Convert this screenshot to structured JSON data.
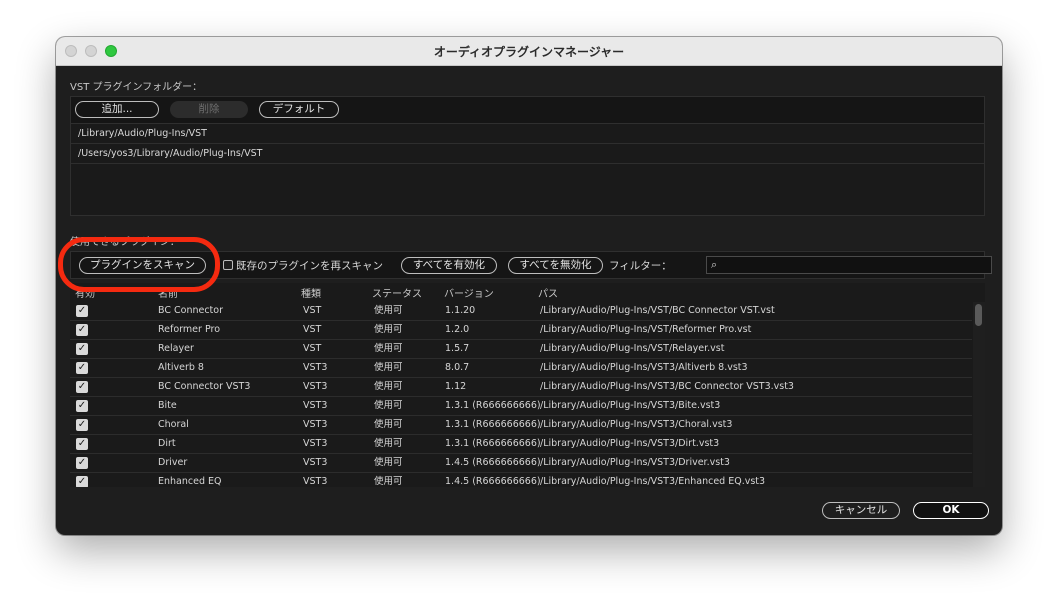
{
  "window": {
    "title": "オーディオプラグインマネージャー"
  },
  "vst_folders": {
    "label": "VST プラグインフォルダー：",
    "add_label": "追加...",
    "delete_label": "削除",
    "default_label": "デフォルト",
    "paths": [
      "/Library/Audio/Plug-Ins/VST",
      "/Users/yos3/Library/Audio/Plug-Ins/VST"
    ]
  },
  "plugins": {
    "label": "使用できるプラグイン：",
    "scan_label": "プラグインをスキャン",
    "rescan_label": "既存のプラグインを再スキャン",
    "enable_all_label": "すべてを有効化",
    "disable_all_label": "すべてを無効化",
    "filter_label": "フィルター：",
    "filter_value": "",
    "columns": {
      "enabled": "有効",
      "name": "名前",
      "type": "種類",
      "status": "ステータス",
      "version": "バージョン",
      "path": "パス"
    },
    "rows": [
      {
        "name": "BC Connector",
        "type": "VST",
        "status": "使用可",
        "version": "1.1.20",
        "path": "/Library/Audio/Plug-Ins/VST/BC Connector VST.vst"
      },
      {
        "name": "Reformer Pro",
        "type": "VST",
        "status": "使用可",
        "version": "1.2.0",
        "path": "/Library/Audio/Plug-Ins/VST/Reformer Pro.vst"
      },
      {
        "name": "Relayer",
        "type": "VST",
        "status": "使用可",
        "version": "1.5.7",
        "path": "/Library/Audio/Plug-Ins/VST/Relayer.vst"
      },
      {
        "name": "Altiverb 8",
        "type": "VST3",
        "status": "使用可",
        "version": "8.0.7",
        "path": "/Library/Audio/Plug-Ins/VST3/Altiverb 8.vst3"
      },
      {
        "name": "BC Connector VST3",
        "type": "VST3",
        "status": "使用可",
        "version": "1.12",
        "path": "/Library/Audio/Plug-Ins/VST3/BC Connector VST3.vst3"
      },
      {
        "name": "Bite",
        "type": "VST3",
        "status": "使用可",
        "version": "1.3.1 (R666666666)",
        "path": "/Library/Audio/Plug-Ins/VST3/Bite.vst3"
      },
      {
        "name": "Choral",
        "type": "VST3",
        "status": "使用可",
        "version": "1.3.1 (R666666666)",
        "path": "/Library/Audio/Plug-Ins/VST3/Choral.vst3"
      },
      {
        "name": "Dirt",
        "type": "VST3",
        "status": "使用可",
        "version": "1.3.1 (R666666666)",
        "path": "/Library/Audio/Plug-Ins/VST3/Dirt.vst3"
      },
      {
        "name": "Driver",
        "type": "VST3",
        "status": "使用可",
        "version": "1.4.5 (R666666666)",
        "path": "/Library/Audio/Plug-Ins/VST3/Driver.vst3"
      },
      {
        "name": "Enhanced EQ",
        "type": "VST3",
        "status": "使用可",
        "version": "1.4.5 (R666666666)",
        "path": "/Library/Audio/Plug-Ins/VST3/Enhanced EQ.vst3"
      }
    ]
  },
  "footer": {
    "cancel_label": "キャンセル",
    "ok_label": "OK"
  },
  "colors": {
    "highlight": "#f52a10",
    "window_bg": "#1e1e1e",
    "traffic_green": "#2fc840"
  }
}
